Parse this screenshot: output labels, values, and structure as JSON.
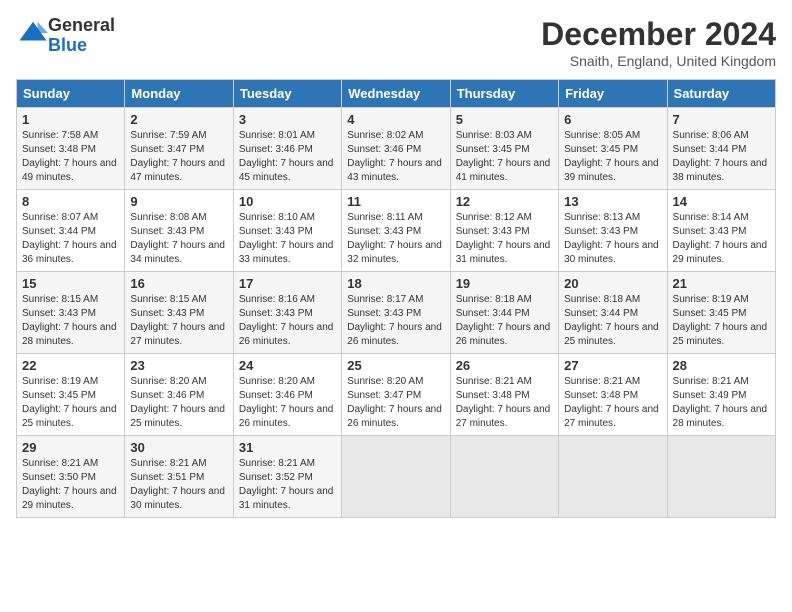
{
  "logo": {
    "general": "General",
    "blue": "Blue"
  },
  "title": "December 2024",
  "subtitle": "Snaith, England, United Kingdom",
  "days_of_week": [
    "Sunday",
    "Monday",
    "Tuesday",
    "Wednesday",
    "Thursday",
    "Friday",
    "Saturday"
  ],
  "weeks": [
    [
      {
        "day": 1,
        "sunrise": "Sunrise: 7:58 AM",
        "sunset": "Sunset: 3:48 PM",
        "daylight": "Daylight: 7 hours and 49 minutes."
      },
      {
        "day": 2,
        "sunrise": "Sunrise: 7:59 AM",
        "sunset": "Sunset: 3:47 PM",
        "daylight": "Daylight: 7 hours and 47 minutes."
      },
      {
        "day": 3,
        "sunrise": "Sunrise: 8:01 AM",
        "sunset": "Sunset: 3:46 PM",
        "daylight": "Daylight: 7 hours and 45 minutes."
      },
      {
        "day": 4,
        "sunrise": "Sunrise: 8:02 AM",
        "sunset": "Sunset: 3:46 PM",
        "daylight": "Daylight: 7 hours and 43 minutes."
      },
      {
        "day": 5,
        "sunrise": "Sunrise: 8:03 AM",
        "sunset": "Sunset: 3:45 PM",
        "daylight": "Daylight: 7 hours and 41 minutes."
      },
      {
        "day": 6,
        "sunrise": "Sunrise: 8:05 AM",
        "sunset": "Sunset: 3:45 PM",
        "daylight": "Daylight: 7 hours and 39 minutes."
      },
      {
        "day": 7,
        "sunrise": "Sunrise: 8:06 AM",
        "sunset": "Sunset: 3:44 PM",
        "daylight": "Daylight: 7 hours and 38 minutes."
      }
    ],
    [
      {
        "day": 8,
        "sunrise": "Sunrise: 8:07 AM",
        "sunset": "Sunset: 3:44 PM",
        "daylight": "Daylight: 7 hours and 36 minutes."
      },
      {
        "day": 9,
        "sunrise": "Sunrise: 8:08 AM",
        "sunset": "Sunset: 3:43 PM",
        "daylight": "Daylight: 7 hours and 34 minutes."
      },
      {
        "day": 10,
        "sunrise": "Sunrise: 8:10 AM",
        "sunset": "Sunset: 3:43 PM",
        "daylight": "Daylight: 7 hours and 33 minutes."
      },
      {
        "day": 11,
        "sunrise": "Sunrise: 8:11 AM",
        "sunset": "Sunset: 3:43 PM",
        "daylight": "Daylight: 7 hours and 32 minutes."
      },
      {
        "day": 12,
        "sunrise": "Sunrise: 8:12 AM",
        "sunset": "Sunset: 3:43 PM",
        "daylight": "Daylight: 7 hours and 31 minutes."
      },
      {
        "day": 13,
        "sunrise": "Sunrise: 8:13 AM",
        "sunset": "Sunset: 3:43 PM",
        "daylight": "Daylight: 7 hours and 30 minutes."
      },
      {
        "day": 14,
        "sunrise": "Sunrise: 8:14 AM",
        "sunset": "Sunset: 3:43 PM",
        "daylight": "Daylight: 7 hours and 29 minutes."
      }
    ],
    [
      {
        "day": 15,
        "sunrise": "Sunrise: 8:15 AM",
        "sunset": "Sunset: 3:43 PM",
        "daylight": "Daylight: 7 hours and 28 minutes."
      },
      {
        "day": 16,
        "sunrise": "Sunrise: 8:15 AM",
        "sunset": "Sunset: 3:43 PM",
        "daylight": "Daylight: 7 hours and 27 minutes."
      },
      {
        "day": 17,
        "sunrise": "Sunrise: 8:16 AM",
        "sunset": "Sunset: 3:43 PM",
        "daylight": "Daylight: 7 hours and 26 minutes."
      },
      {
        "day": 18,
        "sunrise": "Sunrise: 8:17 AM",
        "sunset": "Sunset: 3:43 PM",
        "daylight": "Daylight: 7 hours and 26 minutes."
      },
      {
        "day": 19,
        "sunrise": "Sunrise: 8:18 AM",
        "sunset": "Sunset: 3:44 PM",
        "daylight": "Daylight: 7 hours and 26 minutes."
      },
      {
        "day": 20,
        "sunrise": "Sunrise: 8:18 AM",
        "sunset": "Sunset: 3:44 PM",
        "daylight": "Daylight: 7 hours and 25 minutes."
      },
      {
        "day": 21,
        "sunrise": "Sunrise: 8:19 AM",
        "sunset": "Sunset: 3:45 PM",
        "daylight": "Daylight: 7 hours and 25 minutes."
      }
    ],
    [
      {
        "day": 22,
        "sunrise": "Sunrise: 8:19 AM",
        "sunset": "Sunset: 3:45 PM",
        "daylight": "Daylight: 7 hours and 25 minutes."
      },
      {
        "day": 23,
        "sunrise": "Sunrise: 8:20 AM",
        "sunset": "Sunset: 3:46 PM",
        "daylight": "Daylight: 7 hours and 25 minutes."
      },
      {
        "day": 24,
        "sunrise": "Sunrise: 8:20 AM",
        "sunset": "Sunset: 3:46 PM",
        "daylight": "Daylight: 7 hours and 26 minutes."
      },
      {
        "day": 25,
        "sunrise": "Sunrise: 8:20 AM",
        "sunset": "Sunset: 3:47 PM",
        "daylight": "Daylight: 7 hours and 26 minutes."
      },
      {
        "day": 26,
        "sunrise": "Sunrise: 8:21 AM",
        "sunset": "Sunset: 3:48 PM",
        "daylight": "Daylight: 7 hours and 27 minutes."
      },
      {
        "day": 27,
        "sunrise": "Sunrise: 8:21 AM",
        "sunset": "Sunset: 3:48 PM",
        "daylight": "Daylight: 7 hours and 27 minutes."
      },
      {
        "day": 28,
        "sunrise": "Sunrise: 8:21 AM",
        "sunset": "Sunset: 3:49 PM",
        "daylight": "Daylight: 7 hours and 28 minutes."
      }
    ],
    [
      {
        "day": 29,
        "sunrise": "Sunrise: 8:21 AM",
        "sunset": "Sunset: 3:50 PM",
        "daylight": "Daylight: 7 hours and 29 minutes."
      },
      {
        "day": 30,
        "sunrise": "Sunrise: 8:21 AM",
        "sunset": "Sunset: 3:51 PM",
        "daylight": "Daylight: 7 hours and 30 minutes."
      },
      {
        "day": 31,
        "sunrise": "Sunrise: 8:21 AM",
        "sunset": "Sunset: 3:52 PM",
        "daylight": "Daylight: 7 hours and 31 minutes."
      },
      null,
      null,
      null,
      null
    ]
  ]
}
